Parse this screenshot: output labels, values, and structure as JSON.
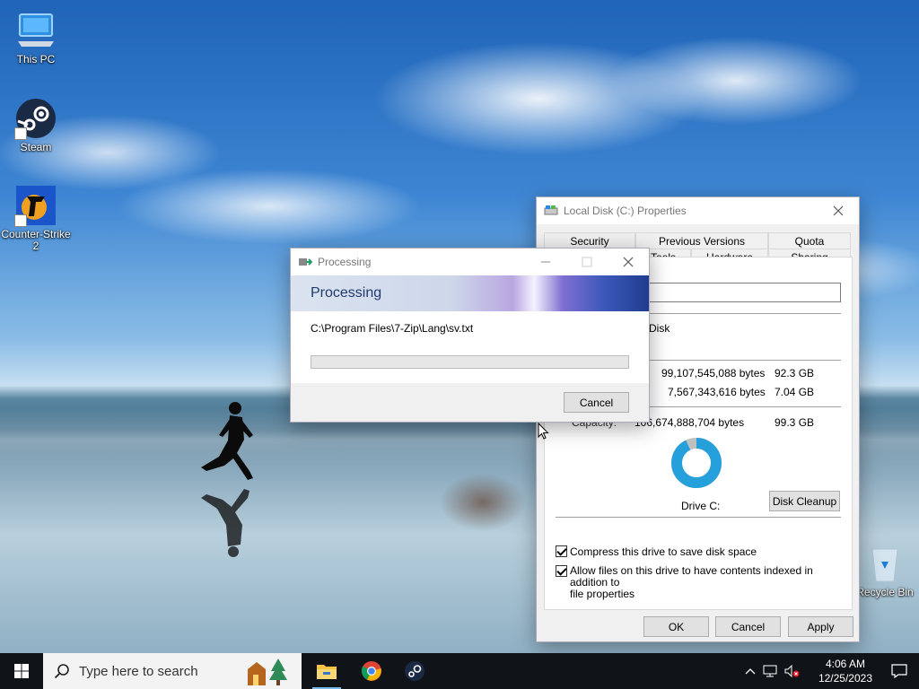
{
  "desktop": {
    "icons": [
      {
        "label": "This PC",
        "icon": "computer-icon"
      },
      {
        "label": "Steam",
        "icon": "steam-icon"
      },
      {
        "label": "Counter-Strike 2",
        "icon": "counter-strike-icon"
      },
      {
        "label": "Recycle Bin",
        "icon": "recycle-bin-icon"
      }
    ]
  },
  "properties": {
    "title": "Local Disk (C:) Properties",
    "tabs_top": [
      "Security",
      "Previous Versions",
      "Quota"
    ],
    "tabs_bottom": [
      "Tools",
      "Hardware",
      "Sharing"
    ],
    "type_fragment": "Disk",
    "used_bytes": "99,107,545,088 bytes",
    "used_gb": "92.3 GB",
    "free_bytes": "7,567,343,616 bytes",
    "free_gb": "7.04 GB",
    "capacity_label": "Capacity:",
    "capacity_bytes": "106,674,888,704 bytes",
    "capacity_gb": "99.3 GB",
    "drive_label": "Drive C:",
    "disk_cleanup": "Disk Cleanup",
    "compress_label": "Compress this drive to save disk space",
    "compress_checked": true,
    "index_label_line1": "Allow files on this drive to have contents indexed in addition to",
    "index_label_line2": "file properties",
    "index_checked": true,
    "ok": "OK",
    "cancel": "Cancel",
    "apply": "Apply",
    "used_fraction": 0.929,
    "colors": {
      "used": "#26a0da",
      "free": "#c0c0c0"
    }
  },
  "processing": {
    "title": "Processing",
    "banner": "Processing",
    "path": "C:\\Program Files\\7-Zip\\Lang\\sv.txt",
    "progress_fraction": 0.0,
    "cancel": "Cancel"
  },
  "taskbar": {
    "search_placeholder": "Type here to search",
    "apps": [
      "file-explorer-icon",
      "chrome-icon",
      "steam-icon"
    ],
    "time": "4:06 AM",
    "date": "12/25/2023"
  }
}
